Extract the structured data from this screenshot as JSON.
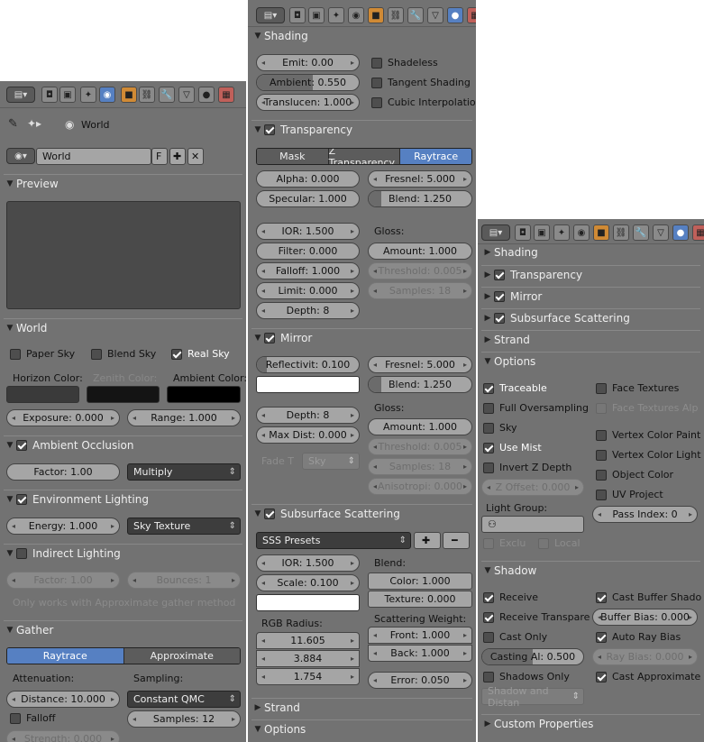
{
  "panel1": {
    "world_label": "World",
    "world_field": "World",
    "world_f": "F",
    "sections": {
      "preview": "Preview",
      "world": "World",
      "ao": "Ambient Occlusion",
      "env": "Environment Lighting",
      "indirect": "Indirect Lighting",
      "gather": "Gather"
    },
    "paper_sky": "Paper Sky",
    "blend_sky": "Blend Sky",
    "real_sky": "Real Sky",
    "horizon_color": "Horizon Color:",
    "zenith_color": "Zenith Color:",
    "ambient_color": "Ambient Color:",
    "exposure": "Exposure: 0.000",
    "range": "Range: 1.000",
    "ao_factor": "Factor: 1.00",
    "ao_mode": "Multiply",
    "env_energy": "Energy: 1.000",
    "env_mode": "Sky Texture",
    "ind_factor": "Factor: 1.00",
    "ind_bounces": "Bounces: 1",
    "ind_note": "Only works with Approximate gather method",
    "gather_raytrace": "Raytrace",
    "gather_approx": "Approximate",
    "attenuation": "Attenuation:",
    "sampling": "Sampling:",
    "distance": "Distance: 10.000",
    "sampling_mode": "Constant QMC",
    "falloff": "Falloff",
    "samples": "Samples: 12",
    "strength": "Strength: 0.000",
    "colors": {
      "horizon": "#3a3a3a",
      "zenith": "#141414",
      "ambient": "#000000"
    }
  },
  "panel2": {
    "sections": {
      "shading": "Shading",
      "transparency": "Transparency",
      "mirror": "Mirror",
      "sss": "Subsurface Scattering",
      "strand": "Strand",
      "options": "Options"
    },
    "emit": "Emit: 0.00",
    "ambient": "Ambient: 0.550",
    "transluc": "Translucen: 1.000",
    "shadeless": "Shadeless",
    "tangent": "Tangent Shading",
    "cubic": "Cubic Interpolatio",
    "mask": "Mask",
    "ztransp": "Z Transparency",
    "raytrace": "Raytrace",
    "alpha": "Alpha: 0.000",
    "fresnel": "Fresnel: 5.000",
    "specular": "Specular: 1.000",
    "blend": "Blend: 1.250",
    "ior": "IOR: 1.500",
    "gloss": "Gloss:",
    "filter": "Filter: 0.000",
    "amount": "Amount: 1.000",
    "falloff": "Falloff: 1.000",
    "threshold": "Threshold: 0.005",
    "limit": "Limit: 0.000",
    "samples": "Samples: 18",
    "depth": "Depth: 8",
    "reflectivity": "Reflectivit: 0.100",
    "m_fresnel": "Fresnel: 5.000",
    "m_blend": "Blend: 1.250",
    "m_depth": "Depth: 8",
    "m_gloss": "Gloss:",
    "m_amount": "Amount: 1.000",
    "maxdist": "Max Dist: 0.000",
    "m_threshold": "Threshold: 0.005",
    "fade": "Fade T",
    "fade_mode": "Sky",
    "m_samples": "Samples: 18",
    "anisotropy": "Anisotropi: 0.000",
    "sss_presets": "SSS Presets",
    "sss_ior": "IOR: 1.500",
    "sss_blend": "Blend:",
    "sss_scale": "Scale: 0.100",
    "sss_color": "Color: 1.000",
    "sss_texture": "Texture: 0.000",
    "rgb_radius": "RGB Radius:",
    "scat_weight": "Scattering Weight:",
    "r1": "11.605",
    "r2": "3.884",
    "r3": "1.754",
    "front": "Front: 1.000",
    "back": "Back: 1.000",
    "error": "Error: 0.050"
  },
  "panel3": {
    "sections": {
      "shading": "Shading",
      "transparency": "Transparency",
      "mirror": "Mirror",
      "sss": "Subsurface Scattering",
      "strand": "Strand",
      "options": "Options",
      "shadow": "Shadow",
      "custom": "Custom Properties"
    },
    "traceable": "Traceable",
    "full_os": "Full Oversampling",
    "sky": "Sky",
    "use_mist": "Use Mist",
    "invert_z": "Invert Z Depth",
    "z_offset": "Z Offset: 0.000",
    "light_group": "Light Group:",
    "exclu": "Exclu",
    "local": "Local",
    "face_tex": "Face Textures",
    "face_tex_alp": "Face Textures Alp",
    "vcol_paint": "Vertex Color Paint",
    "vcol_light": "Vertex Color Light",
    "object_color": "Object Color",
    "uv_project": "UV Project",
    "pass_index": "Pass Index: 0",
    "receive": "Receive",
    "receive_transp": "Receive Transpare",
    "cast_only": "Cast Only",
    "casting_al": "Casting Al: 0.500",
    "shadows_only": "Shadows Only",
    "shadow_mode": "Shadow and Distan",
    "cast_buffer": "Cast Buffer Shado",
    "buffer_bias": "Buffer Bias: 0.000",
    "auto_ray": "Auto Ray Bias",
    "ray_bias": "Ray Bias: 0.000",
    "cast_approx": "Cast Approximate"
  }
}
